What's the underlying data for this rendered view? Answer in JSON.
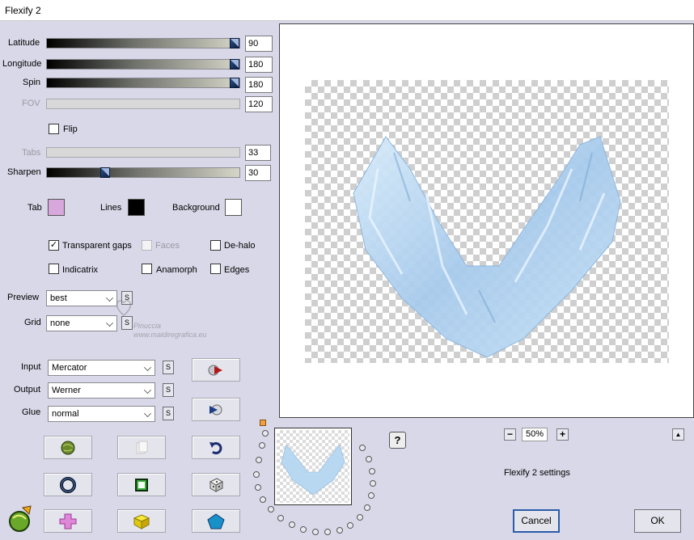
{
  "window": {
    "title": "Flexify 2"
  },
  "params": {
    "latitude": {
      "label": "Latitude",
      "value": "90",
      "fraction": 1.0
    },
    "longitude": {
      "label": "Longitude",
      "value": "180",
      "fraction": 1.0
    },
    "spin": {
      "label": "Spin",
      "value": "180",
      "fraction": 1.0
    },
    "fov": {
      "label": "FOV",
      "value": "120"
    },
    "tabs": {
      "label": "Tabs",
      "value": "33"
    },
    "sharpen": {
      "label": "Sharpen",
      "value": "30",
      "fraction": 0.3
    }
  },
  "flip": {
    "label": "Flip",
    "checked": false
  },
  "colors": {
    "tab": {
      "label": "Tab",
      "color": "#d8a8dc"
    },
    "lines": {
      "label": "Lines",
      "color": "#000000"
    },
    "background": {
      "label": "Background",
      "color": "#ffffff"
    }
  },
  "options": {
    "transparent_gaps": {
      "label": "Transparent gaps",
      "checked": true
    },
    "faces": {
      "label": "Faces",
      "checked": false,
      "disabled": true
    },
    "dehalo": {
      "label": "De-halo",
      "checked": false
    },
    "indicatrix": {
      "label": "Indicatrix",
      "checked": false
    },
    "anamorph": {
      "label": "Anamorph",
      "checked": false
    },
    "edges": {
      "label": "Edges",
      "checked": false
    }
  },
  "preview_select": {
    "label": "Preview",
    "value": "best",
    "s": "S"
  },
  "grid_select": {
    "label": "Grid",
    "value": "none",
    "s": "S"
  },
  "input_select": {
    "label": "Input",
    "value": "Mercator",
    "s": "S"
  },
  "output_select": {
    "label": "Output",
    "value": "Werner",
    "s": "S"
  },
  "glue_select": {
    "label": "Glue",
    "value": "normal",
    "s": "S"
  },
  "watermark": {
    "line1": "Pinuccia",
    "line2": "www.maidiregrafica.eu"
  },
  "zoom": {
    "minus": "−",
    "value": "50%",
    "plus": "+"
  },
  "help": "?",
  "scroll_up": "▲",
  "settings_label": "Flexify 2 settings",
  "buttons": {
    "cancel": "Cancel",
    "ok": "OK"
  },
  "colors_theme": {
    "panel": "#d8d8e8",
    "accent": "#2a5ca8",
    "shape": "#bcdcf4"
  }
}
